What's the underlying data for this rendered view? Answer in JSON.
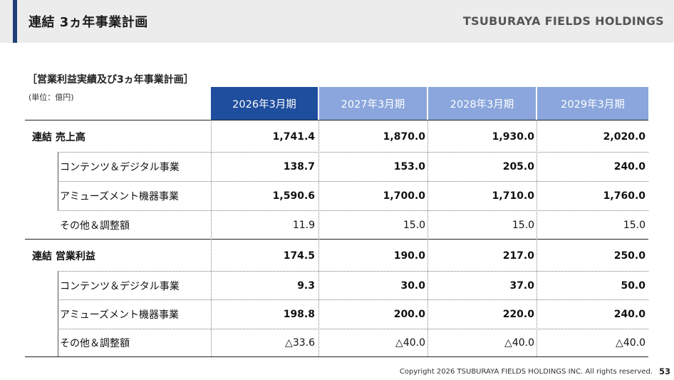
{
  "header": {
    "title": "連結 3ヵ年事業計画",
    "brand": "TSUBURAYA FIELDS HOLDINGS",
    "accent_color": "#1f3f76"
  },
  "section": {
    "title": "［営業利益実績及び3ヵ年事業計画］",
    "unit": "(単位：億円)"
  },
  "table": {
    "columns": [
      "2026年3月期",
      "2027年3月期",
      "2028年3月期",
      "2029年3月期"
    ],
    "column_colors": [
      "#1f4e9e",
      "#8aa6dc",
      "#8aa6dc",
      "#8aa6dc"
    ],
    "rows": [
      {
        "label": "連結 売上高",
        "values": [
          "1,741.4",
          "1,870.0",
          "1,930.0",
          "2,020.0"
        ]
      },
      {
        "label": "コンテンツ＆デジタル事業",
        "values": [
          "138.7",
          "153.0",
          "205.0",
          "240.0"
        ]
      },
      {
        "label": "アミューズメント機器事業",
        "values": [
          "1,590.6",
          "1,700.0",
          "1,710.0",
          "1,760.0"
        ]
      },
      {
        "label": "その他＆調整額",
        "values": [
          "11.9",
          "15.0",
          "15.0",
          "15.0"
        ]
      },
      {
        "label": "連結 営業利益",
        "values": [
          "174.5",
          "190.0",
          "217.0",
          "250.0"
        ]
      },
      {
        "label": "コンテンツ＆デジタル事業",
        "values": [
          "9.3",
          "30.0",
          "37.0",
          "50.0"
        ]
      },
      {
        "label": "アミューズメント機器事業",
        "values": [
          "198.8",
          "200.0",
          "220.0",
          "240.0"
        ]
      },
      {
        "label": "その他＆調整額",
        "values": [
          "△33.6",
          "△40.0",
          "△40.0",
          "△40.0"
        ]
      }
    ]
  },
  "footer": {
    "copyright": "Copyright 2026 TSUBURAYA FIELDS HOLDINGS INC. All rights reserved.",
    "page_number": "53"
  }
}
